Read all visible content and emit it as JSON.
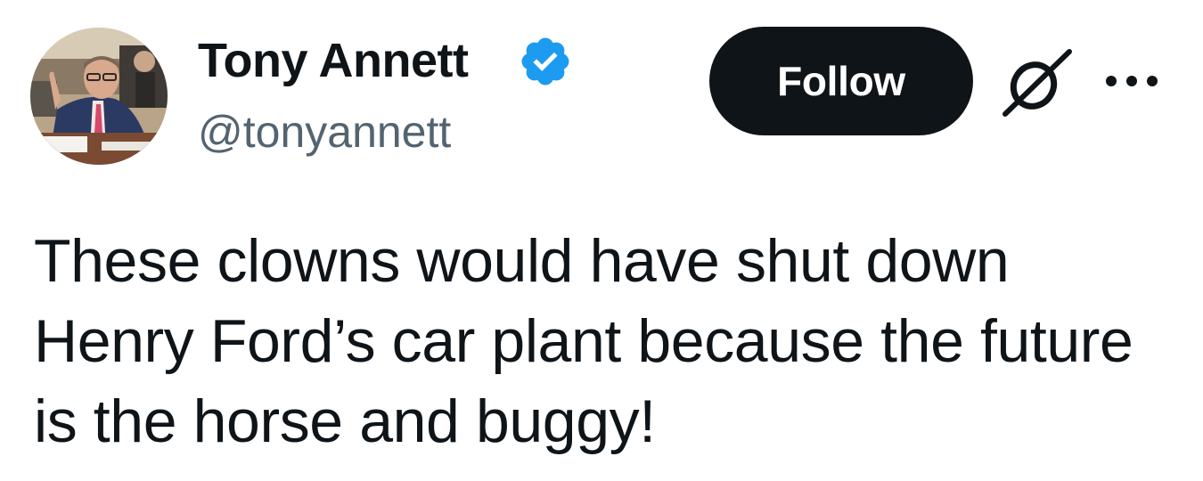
{
  "author": {
    "display_name": "Tony Annett",
    "handle": "@tonyannett",
    "verified": true,
    "avatar_icon": "profile-photo"
  },
  "actions": {
    "follow_label": "Follow",
    "grok_icon": "grok-icon",
    "more_icon": "more-horizontal-icon"
  },
  "tweet": {
    "lines": [
      "These clowns would have shut down",
      "Henry Ford’s car plant because the future",
      "is the horse and buggy!"
    ]
  },
  "colors": {
    "text": "#0f1419",
    "handle": "#536471",
    "verified_badge": "#1d9bf0",
    "follow_bg": "#0f1419",
    "follow_text": "#ffffff"
  }
}
